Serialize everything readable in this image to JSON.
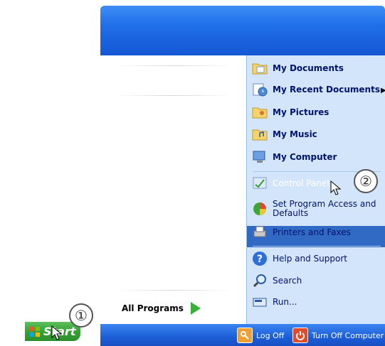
{
  "start_button": {
    "label": "Start"
  },
  "callouts": [
    "①",
    "②"
  ],
  "all_programs": {
    "label": "All Programs"
  },
  "right_items": [
    {
      "label": "My Documents",
      "icon": "folder-documents-icon"
    },
    {
      "label": "My Recent Documents",
      "icon": "recent-documents-icon"
    },
    {
      "label": "My Pictures",
      "icon": "folder-pictures-icon"
    },
    {
      "label": "My Music",
      "icon": "folder-music-icon"
    },
    {
      "label": "My Computer",
      "icon": "computer-icon"
    },
    {
      "label": "Control Panel",
      "icon": "control-panel-icon"
    },
    {
      "label": "Set Program Access and Defaults",
      "icon": "program-access-icon"
    },
    {
      "label": "Printers and Faxes",
      "icon": "printer-icon"
    },
    {
      "label": "Help and Support",
      "icon": "help-icon"
    },
    {
      "label": "Search",
      "icon": "search-icon"
    },
    {
      "label": "Run...",
      "icon": "run-icon"
    }
  ],
  "footer": {
    "log_off": "Log Off",
    "turn_off": "Turn Off Computer"
  },
  "colors": {
    "accent": "#1f6fe8",
    "highlight": "#316ac5",
    "panel": "#d3e5fa",
    "start_green": "#37a537"
  }
}
